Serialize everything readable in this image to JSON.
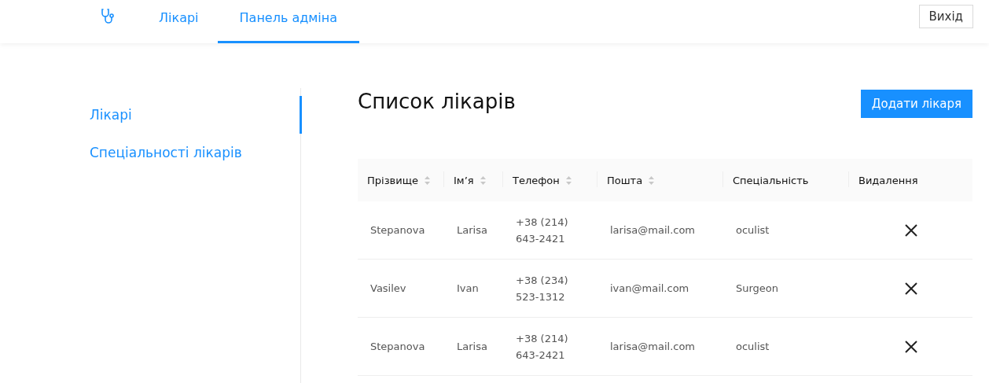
{
  "nav": {
    "tabs": [
      {
        "label": "Лікарі",
        "selected": false
      },
      {
        "label": "Панель адміна",
        "selected": true
      }
    ],
    "logout": "Вихід"
  },
  "sidebar": {
    "items": [
      {
        "label": "Лікарі",
        "selected": true
      },
      {
        "label": "Спеціальності лікарів",
        "selected": false
      }
    ]
  },
  "page": {
    "title": "Список лікарів",
    "add_button": "Додати лікаря"
  },
  "table": {
    "columns": [
      {
        "label": "Прізвище",
        "sortable": true
      },
      {
        "label": "Ім’я",
        "sortable": true
      },
      {
        "label": "Телефон",
        "sortable": true
      },
      {
        "label": "Пошта",
        "sortable": true
      },
      {
        "label": "Спеціальність",
        "sortable": false
      },
      {
        "label": "Видалення",
        "sortable": false
      }
    ],
    "rows": [
      {
        "surname": "Stepanova",
        "name": "Larisa",
        "phone": [
          "+38 (214)",
          "643-2421"
        ],
        "email": "larisa@mail.com",
        "specialty": "oculist"
      },
      {
        "surname": "Vasilev",
        "name": "Ivan",
        "phone": [
          "+38 (234)",
          "523-1312"
        ],
        "email": "ivan@mail.com",
        "specialty": "Surgeon"
      },
      {
        "surname": "Stepanova",
        "name": "Larisa",
        "phone": [
          "+38 (214)",
          "643-2421"
        ],
        "email": "larisa@mail.com",
        "specialty": "oculist"
      }
    ]
  }
}
